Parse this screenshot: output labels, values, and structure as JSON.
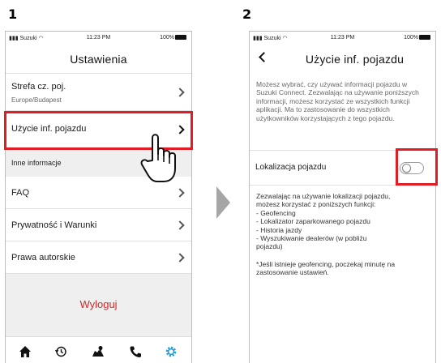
{
  "steps": {
    "one": "1",
    "two": "2"
  },
  "status_bar": {
    "carrier": "Suzuki",
    "time": "11:23 PM",
    "battery": "100%"
  },
  "screen1": {
    "title": "Ustawienia",
    "rows": [
      {
        "label": "Strefa cz. poj.",
        "sub": "Europe/Budapest"
      },
      {
        "label": "Użycie inf. pojazdu"
      }
    ],
    "section_label": "Inne informacje",
    "rows2": [
      {
        "label": "FAQ"
      },
      {
        "label": "Prywatność i Warunki"
      },
      {
        "label": "Prawa autorskie"
      }
    ],
    "logout_label": "Wyloguj",
    "tabs": [
      "home-icon",
      "history-icon",
      "map-icon",
      "phone-icon",
      "settings-icon"
    ]
  },
  "screen2": {
    "title": "Użycie inf. pojazdu",
    "intro": "Możesz wybrać, czy używać informacji pojazdu w Suzuki Connect. Zezwalając na używanie poniższych informacji, możesz korzystać ze wszystkich funkcji aplikacji. Ma to zastosowanie do wszystkich użytkowników korzystających z tego pojazdu.",
    "toggle_label": "Lokalizacja pojazdu",
    "toggle_on": false,
    "desc_lines": [
      "Zezwalając na używanie lokalizacji pojazdu,",
      "możesz korzystać z poniższych funkcji:",
      "- Geofencing",
      "- Lokalizator zaparkowanego pojazdu",
      "- Historia jazdy",
      "- Wyszukiwanie dealerów (w pobliżu",
      "pojazdu)"
    ],
    "note": "*Jeśli istnieje geofencing, poczekaj minutę na zastosowanie ustawień."
  },
  "colors": {
    "highlight": "#e11c24",
    "logout": "#d32a2a",
    "active_tab": "#2a9fd6",
    "arrow": "#a6a6a6"
  }
}
